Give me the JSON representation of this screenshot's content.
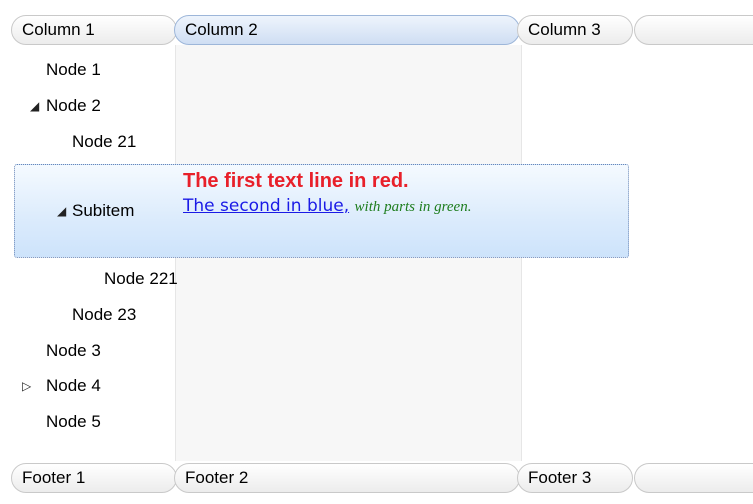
{
  "header": {
    "col1": "Column 1",
    "col2": "Column 2",
    "col3": "Column 3",
    "col4": ""
  },
  "footer": {
    "col1": "Footer 1",
    "col2": "Footer 2",
    "col3": "Footer 3",
    "col4": ""
  },
  "rows": [
    {
      "label": "Node 1",
      "expander": ""
    },
    {
      "label": "Node 2",
      "expander": "◢"
    },
    {
      "label": "Node 21",
      "expander": ""
    },
    {
      "label": "Subitem",
      "expander": "◢"
    },
    {
      "label": "Node 221",
      "expander": ""
    },
    {
      "label": "Node 23",
      "expander": ""
    },
    {
      "label": "Node 3",
      "expander": ""
    },
    {
      "label": "Node 4",
      "expander": "▷"
    },
    {
      "label": "Node 5",
      "expander": ""
    }
  ],
  "selected_item": {
    "line1": "The first text line in red.",
    "line2_blue": "The second in blue,",
    "line2_green": "with parts in green."
  },
  "colors": {
    "red": "#e8202a",
    "blue": "#1a1ae6",
    "green": "#1e7d1e",
    "selection": "#cde3fb"
  }
}
